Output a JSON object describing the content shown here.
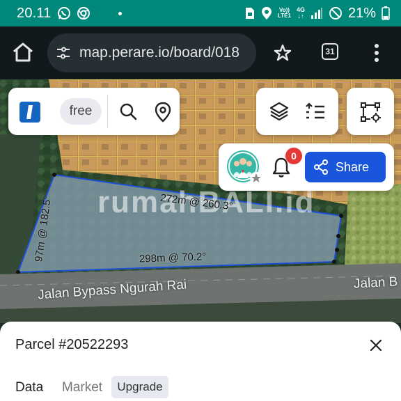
{
  "status_bar": {
    "time": "20.11",
    "network_top": "Vo))",
    "network_bottom": "LTE1",
    "gen_label": "4G",
    "battery_percent": "21%"
  },
  "browser": {
    "url": "map.perare.io/board/018",
    "tab_count": "31"
  },
  "map_toolbar": {
    "plan_badge": "free"
  },
  "notifications": {
    "count": "0"
  },
  "share_button": {
    "label": "Share"
  },
  "map": {
    "watermark": "rumahBALI.id",
    "dimensions": {
      "top": "272m @ 260.3°",
      "left": "97m @ 182.5°",
      "bottom": "298m @ 70.2°"
    },
    "road_labels": [
      "Jalan Bypass Ngurah Rai",
      "Jalan B"
    ]
  },
  "sheet": {
    "title": "Parcel #20522293",
    "tabs": [
      {
        "label": "Data",
        "active": true
      },
      {
        "label": "Market",
        "active": false
      }
    ],
    "upgrade_label": "Upgrade"
  },
  "colors": {
    "status_bar": "#00897b",
    "browser_bar": "#12191c",
    "accent": "#1a56db",
    "badge": "#e53935",
    "parcel_outline": "#1e4fd8"
  }
}
